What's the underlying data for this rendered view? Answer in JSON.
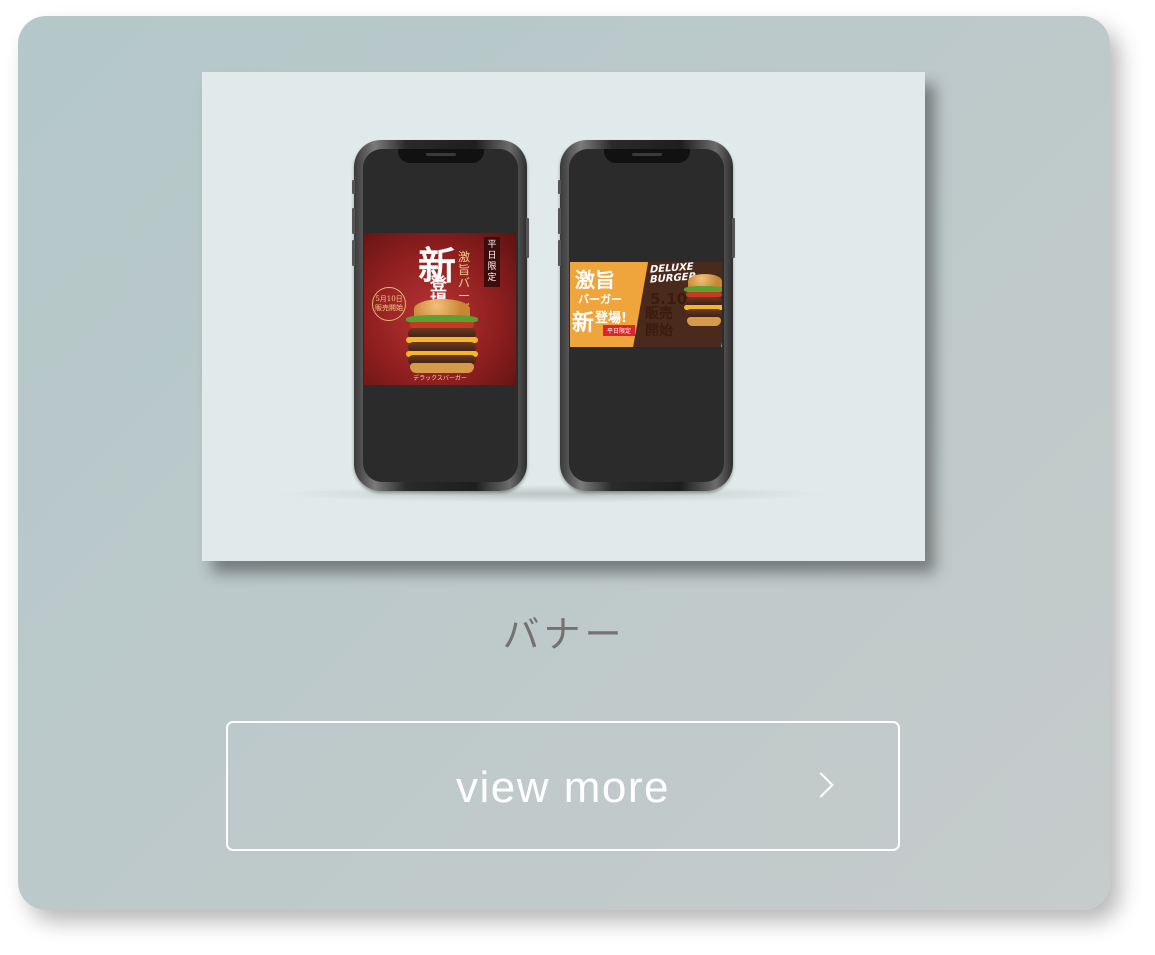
{
  "card": {
    "title": "バナー",
    "button_label": "view more",
    "button_icon": "chevron-right-icon",
    "background_color": "#b4c8c9"
  },
  "mockup": {
    "banner_square": {
      "badge": "平日限定",
      "headline_big": "新",
      "headline_sub": "激旨バーガ",
      "headline_sub2": "登場",
      "date_line1": "5月10日",
      "date_line2": "販売開始",
      "footer": "デラックスバーガー"
    },
    "banner_wide": {
      "headline": "激旨",
      "sub": "バーガー",
      "new": "新",
      "arrival": "登場!",
      "tag": "平日限定",
      "logo_line1": "DELUXE",
      "logo_line2": "BURGER",
      "date": "5.10",
      "sell": "販売開始"
    }
  }
}
